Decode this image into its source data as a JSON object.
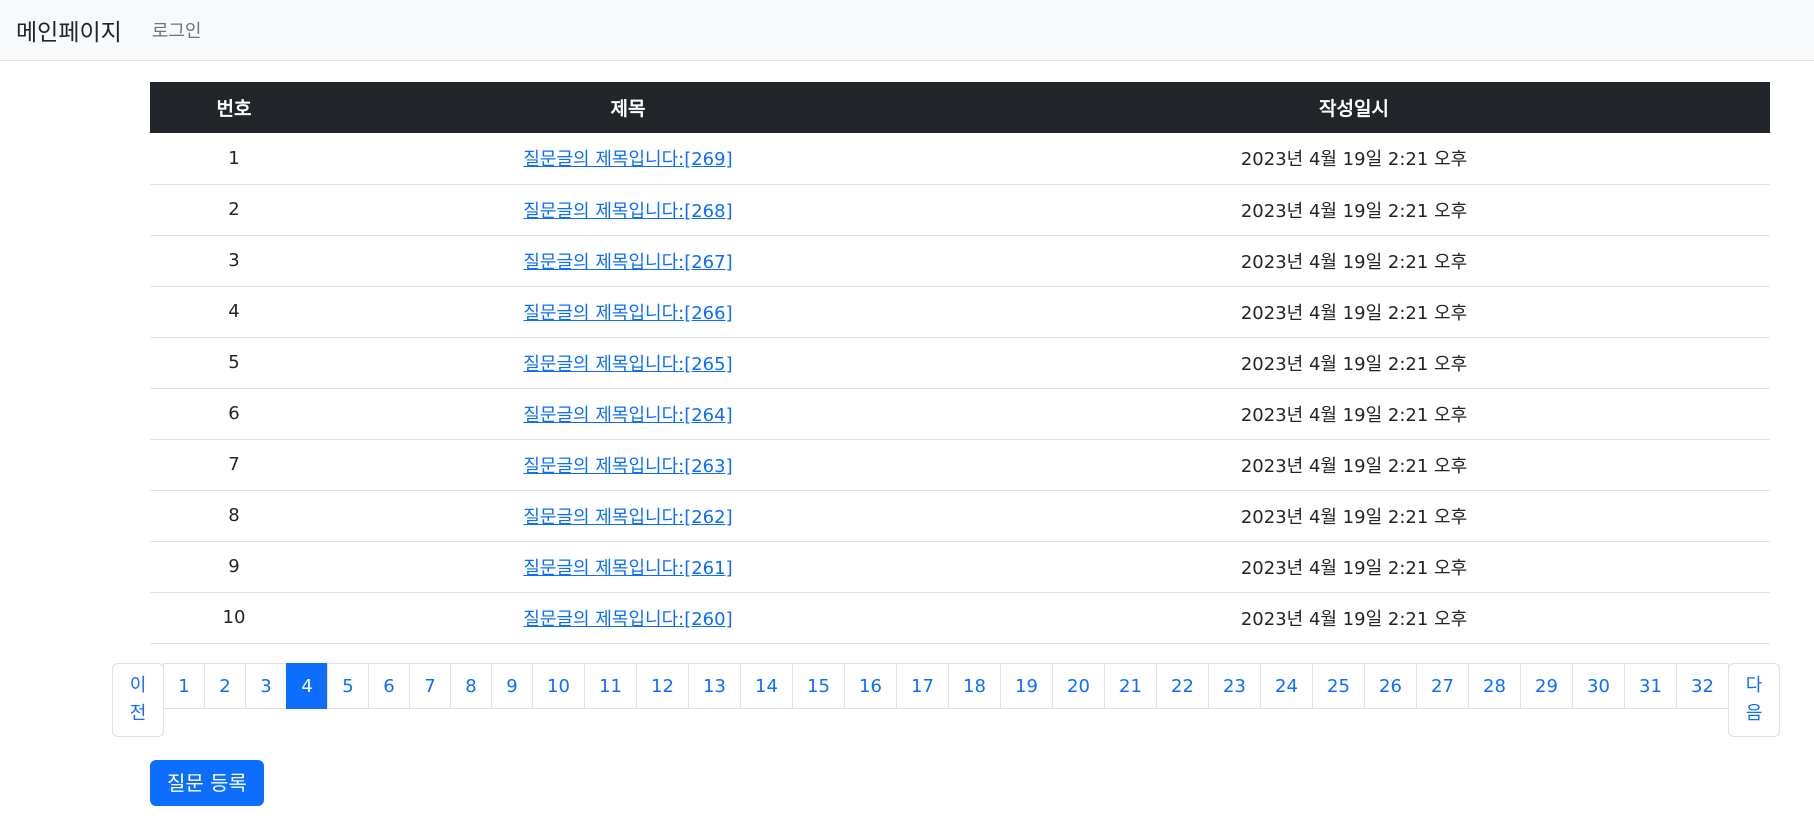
{
  "navbar": {
    "brand": "메인페이지",
    "login": "로그인"
  },
  "table": {
    "headers": [
      "번호",
      "제목",
      "작성일시"
    ],
    "rows": [
      {
        "num": "1",
        "title": "질문글의 제목입니다:[269]",
        "date": "2023년 4월 19일 2:21 오후"
      },
      {
        "num": "2",
        "title": "질문글의 제목입니다:[268]",
        "date": "2023년 4월 19일 2:21 오후"
      },
      {
        "num": "3",
        "title": "질문글의 제목입니다:[267]",
        "date": "2023년 4월 19일 2:21 오후"
      },
      {
        "num": "4",
        "title": "질문글의 제목입니다:[266]",
        "date": "2023년 4월 19일 2:21 오후"
      },
      {
        "num": "5",
        "title": "질문글의 제목입니다:[265]",
        "date": "2023년 4월 19일 2:21 오후"
      },
      {
        "num": "6",
        "title": "질문글의 제목입니다:[264]",
        "date": "2023년 4월 19일 2:21 오후"
      },
      {
        "num": "7",
        "title": "질문글의 제목입니다:[263]",
        "date": "2023년 4월 19일 2:21 오후"
      },
      {
        "num": "8",
        "title": "질문글의 제목입니다:[262]",
        "date": "2023년 4월 19일 2:21 오후"
      },
      {
        "num": "9",
        "title": "질문글의 제목입니다:[261]",
        "date": "2023년 4월 19일 2:21 오후"
      },
      {
        "num": "10",
        "title": "질문글의 제목입니다:[260]",
        "date": "2023년 4월 19일 2:21 오후"
      }
    ]
  },
  "pagination": {
    "prev": "이전",
    "next": "다음",
    "active": "4",
    "pages": [
      "1",
      "2",
      "3",
      "4",
      "5",
      "6",
      "7",
      "8",
      "9",
      "10",
      "11",
      "12",
      "13",
      "14",
      "15",
      "16",
      "17",
      "18",
      "19",
      "20",
      "21",
      "22",
      "23",
      "24",
      "25",
      "26",
      "27",
      "28",
      "29",
      "30",
      "31",
      "32"
    ]
  },
  "actions": {
    "create_label": "질문 등록"
  },
  "colors": {
    "primary": "#0d6efd",
    "header_bg": "#212529",
    "navbar_bg": "#f8f9fa"
  }
}
